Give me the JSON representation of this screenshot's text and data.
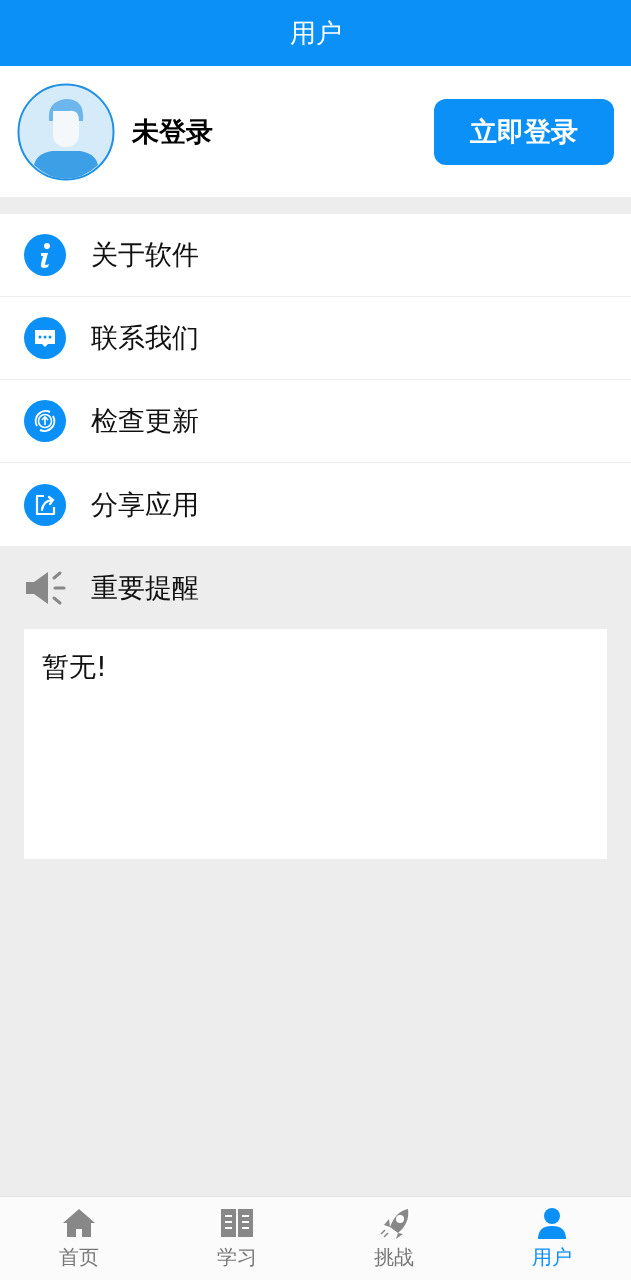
{
  "header": {
    "title": "用户"
  },
  "profile": {
    "name": "未登录",
    "login_button": "立即登录"
  },
  "menu": [
    {
      "kind": "info",
      "label": "关于软件"
    },
    {
      "kind": "chat",
      "label": "联系我们"
    },
    {
      "kind": "update",
      "label": "检查更新"
    },
    {
      "kind": "share",
      "label": "分享应用"
    }
  ],
  "notice": {
    "title": "重要提醒",
    "text": "暂无!"
  },
  "tab_bar": [
    {
      "kind": "home",
      "label": "首页",
      "selected": false
    },
    {
      "kind": "book",
      "label": "学习",
      "selected": false
    },
    {
      "kind": "rocket",
      "label": "挑战",
      "selected": false
    },
    {
      "kind": "user",
      "label": "用户",
      "selected": true
    }
  ]
}
